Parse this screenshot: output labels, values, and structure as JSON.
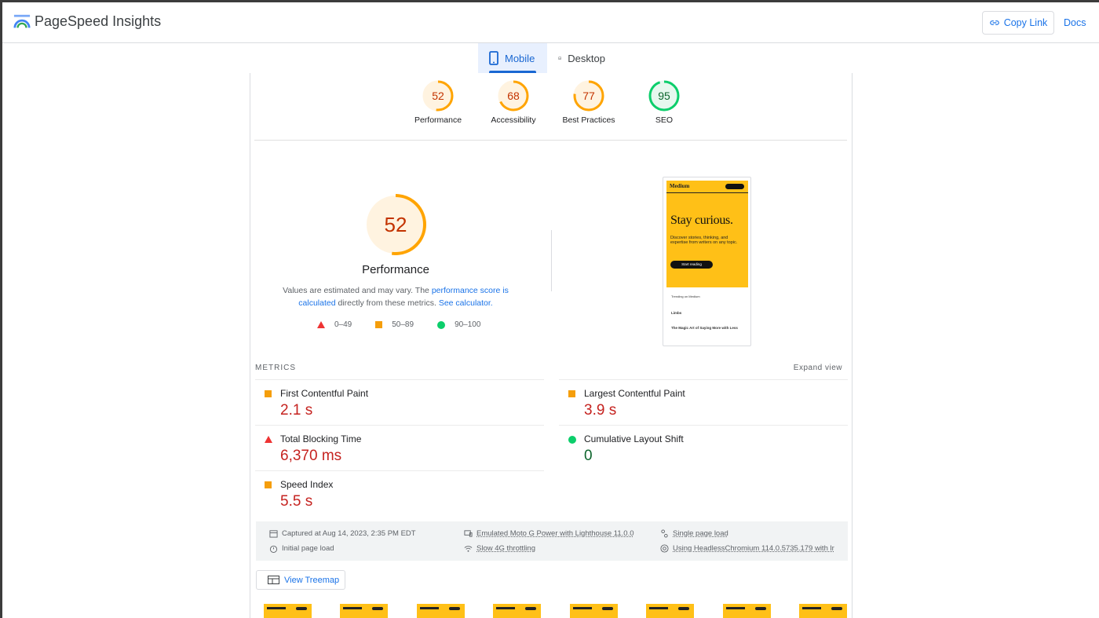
{
  "header": {
    "brand": "PageSpeed Insights",
    "copy_link": "Copy Link",
    "docs": "Docs"
  },
  "tabs": [
    {
      "label": "Mobile",
      "active": true
    },
    {
      "label": "Desktop",
      "active": false
    }
  ],
  "categories": [
    {
      "score": "52",
      "label": "Performance",
      "status": "average"
    },
    {
      "score": "68",
      "label": "Accessibility",
      "status": "average"
    },
    {
      "score": "77",
      "label": "Best Practices",
      "status": "average"
    },
    {
      "score": "95",
      "label": "SEO",
      "status": "pass"
    }
  ],
  "performance": {
    "score": "52",
    "score_fraction": 0.52,
    "title": "Performance",
    "note_prefix": "Values are estimated and may vary. The ",
    "note_link": "performance score is calculated",
    "note_middle": " directly from these metrics. ",
    "note_link2": "See calculator.",
    "legend": [
      "0–49",
      "50–89",
      "90–100"
    ]
  },
  "preview": {
    "logo": "Medium",
    "headline": "Stay curious.",
    "body": "Discover stories, thinking, and expertise from writers on any topic.",
    "cta": "Start reading",
    "trending": "Trending on Medium",
    "item1_title": "Limbs",
    "item2_title": "The Magic Art of Saying More with Less"
  },
  "metrics": {
    "label": "METRICS",
    "expand": "Expand view",
    "items": [
      {
        "name": "First Contentful Paint",
        "value": "2.1 s",
        "status": "average"
      },
      {
        "name": "Largest Contentful Paint",
        "value": "3.9 s",
        "status": "average"
      },
      {
        "name": "Total Blocking Time",
        "value": "6,370 ms",
        "status": "fail"
      },
      {
        "name": "Cumulative Layout Shift",
        "value": "0",
        "status": "pass"
      },
      {
        "name": "Speed Index",
        "value": "5.5 s",
        "status": "average"
      }
    ]
  },
  "info": {
    "captured": "Captured at Aug 14, 2023, 2:35 PM EDT",
    "initial": "Initial page load",
    "emulated": "Emulated Moto G Power with Lighthouse 11.0.0",
    "throttling": "Slow 4G throttling",
    "single": "Single page load",
    "browser": "Using HeadlessChromium 114.0.5735.179 with lr"
  },
  "treemap": "View Treemap",
  "colors": {
    "average": "#ffa400",
    "pass": "#0cce6b",
    "fail": "#ff4e42",
    "accent": "#1a73e8"
  }
}
